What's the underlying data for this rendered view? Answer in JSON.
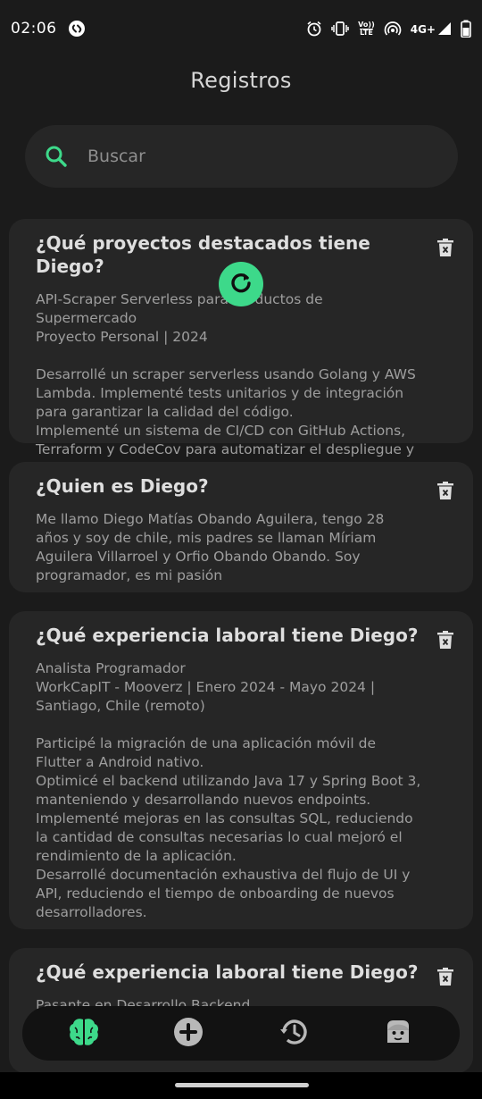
{
  "status": {
    "time": "02:06",
    "network": "4G+",
    "volte_top": "Vo))",
    "volte_bottom": "LTE",
    "icons": [
      "shazam-icon",
      "alarm-icon",
      "vibrate-icon",
      "volte-icon",
      "hotspot-icon",
      "signal-icon",
      "battery-icon"
    ]
  },
  "header": {
    "title": "Registros"
  },
  "search": {
    "placeholder": "Buscar"
  },
  "cards": [
    {
      "title": "¿Qué proyectos destacados tiene Diego?",
      "body": "API-Scraper Serverless para Productos de Supermercado\n Proyecto Personal | 2024\n\nDesarrollé un scraper serverless usando Golang y AWS Lambda. Implementé tests unitarios y de integración para garantizar la calidad del código.\nImplementé un sistema de CI/CD con GitHub Actions, Terraform y CodeCov para automatizar el despliegue y pruebas."
    },
    {
      "title": "¿Quien es Diego?",
      "body": "Me llamo Diego Matías Obando Aguilera, tengo 28 años y soy de chile, mis padres se llaman Míriam Aguilera Villarroel y Orfio Obando Obando. Soy programador, es mi pasión"
    },
    {
      "title": "¿Qué experiencia laboral tiene Diego?",
      "body": "Analista Programador\n WorkCapIT - Mooverz | Enero 2024 - Mayo 2024 | Santiago, Chile (remoto)\n\nParticipé la migración de una aplicación móvil de Flutter a Android nativo.\nOptimicé el backend utilizando Java 17 y Spring Boot 3, manteniendo y desarrollando nuevos endpoints.\nImplementé mejoras en las consultas SQL, reduciendo la cantidad de consultas necesarias lo cual mejoró el rendimiento de la aplicación.\nDesarrollé documentación exhaustiva del flujo de UI y API, reduciendo el tiempo de onboarding de nuevos desarrolladores."
    },
    {
      "title": "¿Qué experiencia laboral tiene Diego?",
      "body": "Pasante en Desarrollo Backend"
    }
  ],
  "nav": {
    "items": [
      "brain-icon",
      "add-icon",
      "history-icon",
      "profile-icon"
    ],
    "active": "brain-icon"
  },
  "colors": {
    "accent": "#3dd98a",
    "background": "#1b1b1b",
    "card": "#262626",
    "nav": "#121212"
  }
}
